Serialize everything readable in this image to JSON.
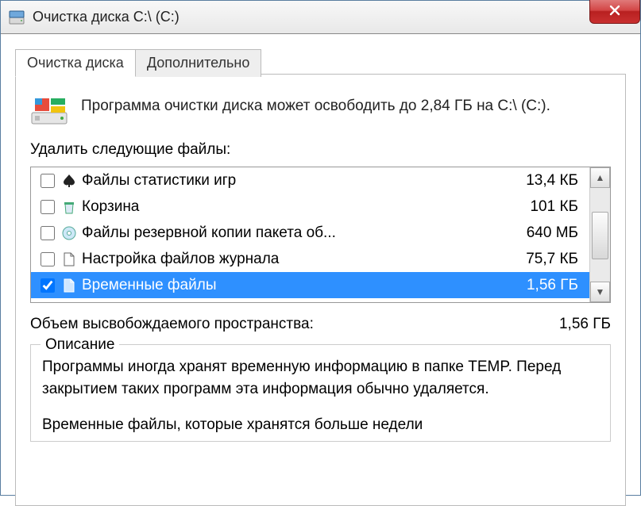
{
  "window": {
    "title": "Очистка диска C:\\ (C:)"
  },
  "tabs": [
    {
      "label": "Очистка диска",
      "active": true
    },
    {
      "label": "Дополнительно",
      "active": false
    }
  ],
  "header": {
    "text": "Программа очистки диска может освободить до 2,84 ГБ на C:\\ (C:)."
  },
  "deleteLabel": "Удалить следующие файлы:",
  "rows": [
    {
      "icon": "spade-icon",
      "label": "Файлы статистики игр",
      "size": "13,4 КБ",
      "checked": false,
      "selected": false
    },
    {
      "icon": "recycle-bin-icon",
      "label": "Корзина",
      "size": "101 КБ",
      "checked": false,
      "selected": false
    },
    {
      "icon": "disc-icon",
      "label": "Файлы резервной копии пакета об...",
      "size": "640 МБ",
      "checked": false,
      "selected": false
    },
    {
      "icon": "file-icon",
      "label": "Настройка файлов журнала",
      "size": "75,7 КБ",
      "checked": false,
      "selected": false
    },
    {
      "icon": "file-icon",
      "label": "Временные файлы",
      "size": "1,56 ГБ",
      "checked": true,
      "selected": true
    }
  ],
  "total": {
    "label": "Объем высвобождаемого пространства:",
    "value": "1,56 ГБ"
  },
  "description": {
    "title": "Описание",
    "body": "Программы иногда хранят временную информацию в папке TEMP. Перед закрытием таких программ эта информация обычно удаляется.",
    "body2": "Временные файлы, которые хранятся больше недели"
  }
}
